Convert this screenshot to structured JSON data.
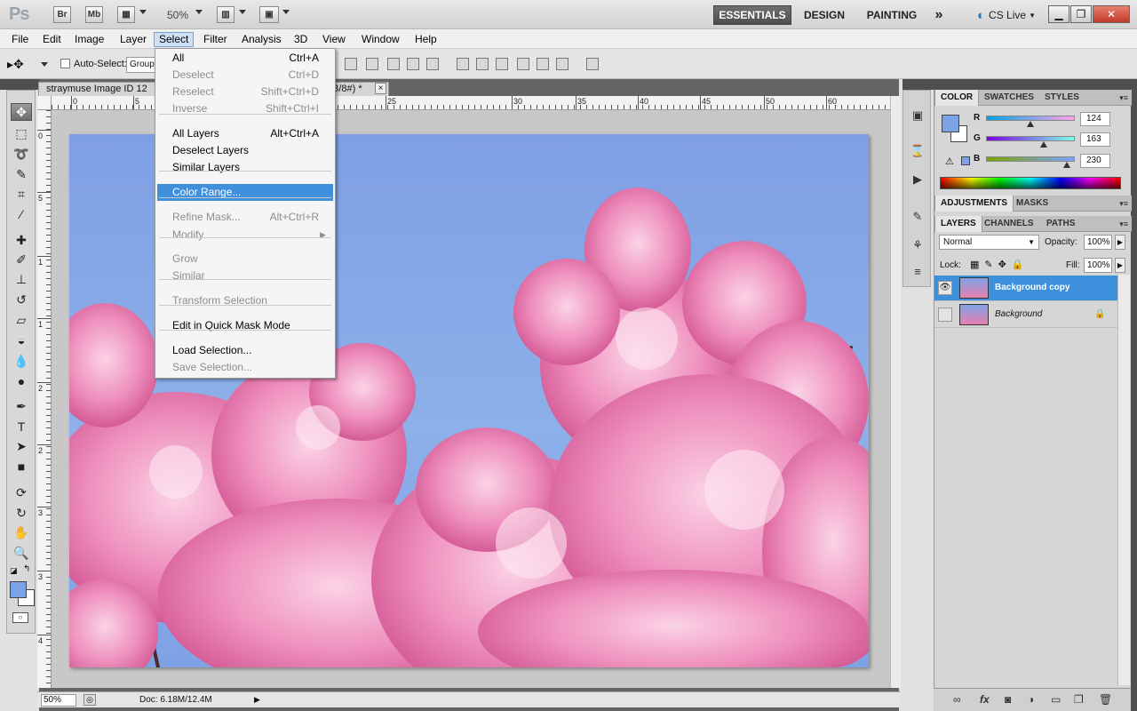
{
  "appbar": {
    "logo": "Ps",
    "bridge": "Br",
    "minibridge": "Mb",
    "zoom": "50%",
    "workspaces": [
      "ESSENTIALS",
      "DESIGN",
      "PAINTING"
    ],
    "more": "»",
    "cslive": "CS Live"
  },
  "menubar": [
    "File",
    "Edit",
    "Image",
    "Layer",
    "Select",
    "Filter",
    "Analysis",
    "3D",
    "View",
    "Window",
    "Help"
  ],
  "options": {
    "auto_select_label": "Auto-Select:",
    "auto_select_value": "Group"
  },
  "document": {
    "tab_title": "straymuse Image ID 12",
    "tab_title_suffix": "B/8#) *",
    "close": "×",
    "ruler_top_labels": [
      "0",
      "5",
      "25",
      "30",
      "35",
      "40",
      "45",
      "50",
      "55",
      "60"
    ],
    "ruler_left_labels": [
      "0",
      "5",
      "1",
      "1",
      "2",
      "2",
      "3",
      "3",
      "4"
    ],
    "status_zoom": "50%",
    "status_doc": "Doc: 6.18M/12.4M"
  },
  "select_menu": {
    "items": [
      {
        "label": "All",
        "shortcut": "Ctrl+A",
        "enabled": true
      },
      {
        "label": "Deselect",
        "shortcut": "Ctrl+D",
        "enabled": false
      },
      {
        "label": "Reselect",
        "shortcut": "Shift+Ctrl+D",
        "enabled": false
      },
      {
        "label": "Inverse",
        "shortcut": "Shift+Ctrl+I",
        "enabled": false
      },
      {
        "label": "All Layers",
        "shortcut": "Alt+Ctrl+A",
        "enabled": true
      },
      {
        "label": "Deselect Layers",
        "shortcut": "",
        "enabled": true
      },
      {
        "label": "Similar Layers",
        "shortcut": "",
        "enabled": true
      },
      {
        "label": "Color Range...",
        "shortcut": "",
        "enabled": true,
        "highlighted": true
      },
      {
        "label": "Refine Mask...",
        "shortcut": "Alt+Ctrl+R",
        "enabled": false
      },
      {
        "label": "Modify",
        "shortcut": "",
        "enabled": false,
        "submenu": true
      },
      {
        "label": "Grow",
        "shortcut": "",
        "enabled": false
      },
      {
        "label": "Similar",
        "shortcut": "",
        "enabled": false
      },
      {
        "label": "Transform Selection",
        "shortcut": "",
        "enabled": false
      },
      {
        "label": "Edit in Quick Mask Mode",
        "shortcut": "",
        "enabled": true
      },
      {
        "label": "Load Selection...",
        "shortcut": "",
        "enabled": true
      },
      {
        "label": "Save Selection...",
        "shortcut": "",
        "enabled": false
      }
    ]
  },
  "color_panel": {
    "tabs": [
      "COLOR",
      "SWATCHES",
      "STYLES"
    ],
    "r_label": "R",
    "g_label": "G",
    "b_label": "B",
    "r": "124",
    "g": "163",
    "b": "230",
    "r_frac": 0.486,
    "g_frac": 0.639,
    "b_frac": 0.902,
    "foreground": "#7ca3e6",
    "background": "#ffffff"
  },
  "adjustments_panel": {
    "tabs": [
      "ADJUSTMENTS",
      "MASKS"
    ]
  },
  "layers_panel": {
    "tabs": [
      "LAYERS",
      "CHANNELS",
      "PATHS"
    ],
    "blend_mode": "Normal",
    "opacity_label": "Opacity:",
    "opacity": "100%",
    "lock_label": "Lock:",
    "fill_label": "Fill:",
    "fill": "100%",
    "layers": [
      {
        "name": "Background copy",
        "selected": true,
        "visible": true
      },
      {
        "name": "Background",
        "selected": false,
        "visible": false,
        "locked": true
      }
    ]
  },
  "colors": {
    "highlight": "#3e8fdc",
    "sky": "#7ca3e6",
    "blossom": "#ea7fb2"
  }
}
